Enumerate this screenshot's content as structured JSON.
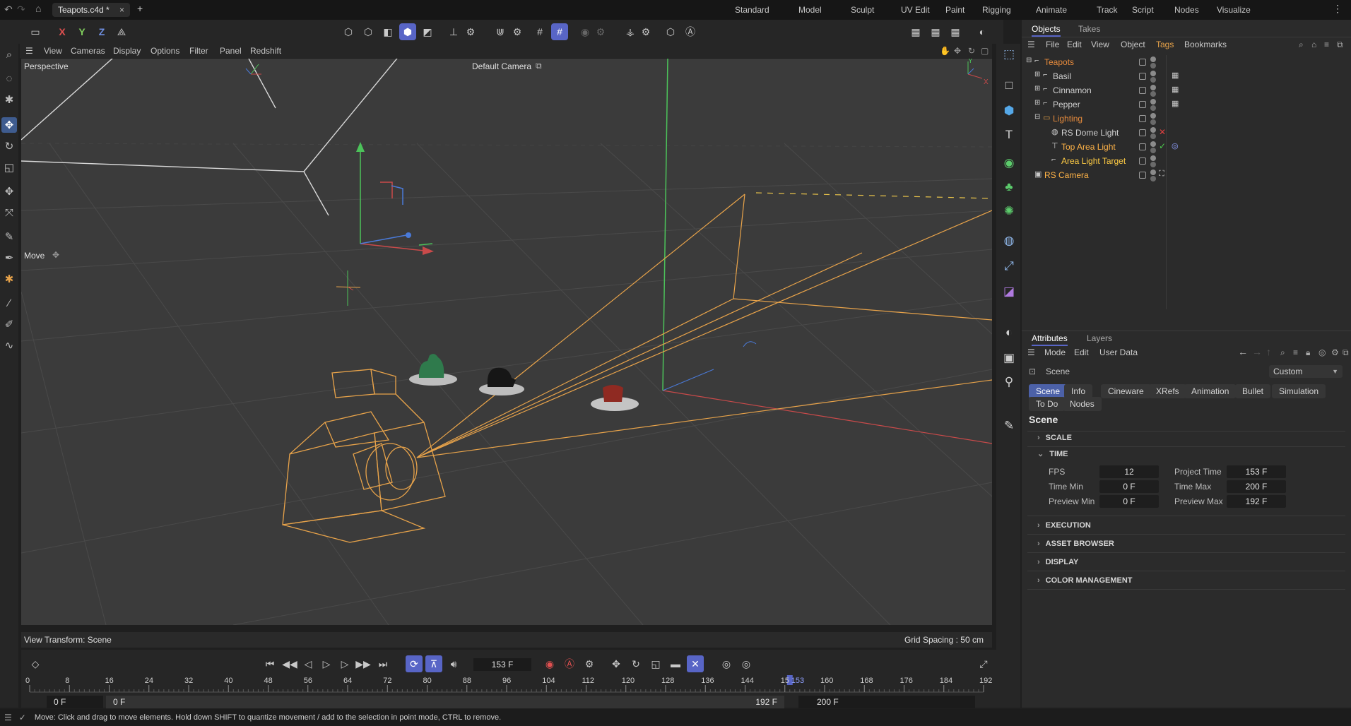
{
  "titlebar": {
    "file_tab": "Teapots.c4d *",
    "close_glyph": "×",
    "add_glyph": "+",
    "layouts": [
      "Standard",
      "Model",
      "Sculpt",
      "UV Edit",
      "Paint",
      "Rigging",
      "Animate",
      "Track",
      "Script",
      "Nodes",
      "Visualize"
    ],
    "more_glyph": "⋮"
  },
  "main_toolbar": {
    "axis_x": "X",
    "axis_y": "Y",
    "axis_z": "Z"
  },
  "viewport_menu": [
    "View",
    "Cameras",
    "Display",
    "Options",
    "Filter",
    "Panel",
    "Redshift"
  ],
  "viewport": {
    "name": "Perspective",
    "camera": "Default Camera",
    "tool_label": "Move",
    "view_transform": "View Transform: Scene",
    "grid_spacing": "Grid Spacing : 50 cm",
    "axis_y_label": "Y",
    "axis_x_label": "X",
    "axis_z_label": "Z"
  },
  "objects_panel": {
    "tabs": [
      "Objects",
      "Takes"
    ],
    "menu": [
      "File",
      "Edit",
      "View",
      "Object",
      "Tags",
      "Bookmarks"
    ],
    "active_menu": "Tags",
    "items": [
      {
        "name": "Teapots",
        "color": "#e58a3c",
        "indent": 0,
        "icon": "null-icon",
        "expand": "−"
      },
      {
        "name": "Basil",
        "color": "#d0d0d0",
        "indent": 1,
        "icon": "null-icon",
        "expand": "+",
        "tag": "display-tag-icon"
      },
      {
        "name": "Cinnamon",
        "color": "#d0d0d0",
        "indent": 1,
        "icon": "null-icon",
        "expand": "+",
        "tag": "display-tag-icon"
      },
      {
        "name": "Pepper",
        "color": "#d0d0d0",
        "indent": 1,
        "icon": "null-icon",
        "expand": "+",
        "tag": "display-tag-icon"
      },
      {
        "name": "Lighting",
        "color": "#e58a3c",
        "indent": 1,
        "icon": "folder-icon",
        "expand": "−"
      },
      {
        "name": "RS Dome Light",
        "color": "#d0d0d0",
        "indent": 2,
        "icon": "dome-light-icon",
        "status": "✕",
        "status_color": "#e04040"
      },
      {
        "name": "Top Area Light",
        "color": "#ffb347",
        "indent": 2,
        "icon": "area-light-icon",
        "status": "✓",
        "status_color": "#4ccc4c",
        "tag": "target-tag-icon"
      },
      {
        "name": "Area Light Target",
        "color": "#ffcc44",
        "indent": 2,
        "icon": "null-icon"
      },
      {
        "name": "RS Camera",
        "color": "#ffb347",
        "indent": 0,
        "icon": "camera-icon",
        "tag": "camera-tag-icon"
      }
    ]
  },
  "attributes_panel": {
    "tabs": [
      "Attributes",
      "Layers"
    ],
    "menu": [
      "Mode",
      "Edit",
      "User Data"
    ],
    "object_label": "Scene",
    "preset": "Custom",
    "chips": [
      "Scene",
      "Info",
      "Cineware",
      "XRefs",
      "Animation",
      "Bullet",
      "Simulation",
      "To Do",
      "Nodes"
    ],
    "active_chip": "Scene",
    "section_title": "Scene",
    "sections": {
      "scale": "SCALE",
      "time": "TIME",
      "execution": "EXECUTION",
      "asset_browser": "ASSET BROWSER",
      "display": "DISPLAY",
      "color_management": "COLOR MANAGEMENT"
    },
    "fields": {
      "fps_label": "FPS",
      "fps": "12",
      "project_time_label": "Project Time",
      "project_time": "153 F",
      "time_min_label": "Time Min",
      "time_min": "0 F",
      "time_max_label": "Time Max",
      "time_max": "200 F",
      "preview_min_label": "Preview Min",
      "preview_min": "0 F",
      "preview_max_label": "Preview Max",
      "preview_max": "192 F"
    }
  },
  "timeline": {
    "current_frame": "153 F",
    "ticks": [
      "0",
      "8",
      "16",
      "24",
      "32",
      "40",
      "48",
      "56",
      "64",
      "72",
      "80",
      "88",
      "96",
      "104",
      "112",
      "120",
      "128",
      "136",
      "144",
      "15",
      "153",
      "160",
      "168",
      "176",
      "184",
      "192"
    ],
    "tick_values": [
      0,
      8,
      16,
      24,
      32,
      40,
      48,
      56,
      64,
      72,
      80,
      88,
      96,
      104,
      112,
      120,
      128,
      136,
      144,
      152,
      153,
      160,
      168,
      176,
      184,
      192
    ],
    "playhead": 153,
    "range_max": 192,
    "start_field": "0 F",
    "preview_start": "0 F",
    "preview_end": "192 F",
    "end_field": "200 F"
  },
  "statusbar": {
    "message": "Move: Click and drag to move elements. Hold down SHIFT to quantize movement / add to the selection in point mode, CTRL to remove."
  },
  "colors": {
    "accent": "#5865c6",
    "selection_orange": "#e58a3c",
    "wire_orange": "#e8a34a"
  }
}
